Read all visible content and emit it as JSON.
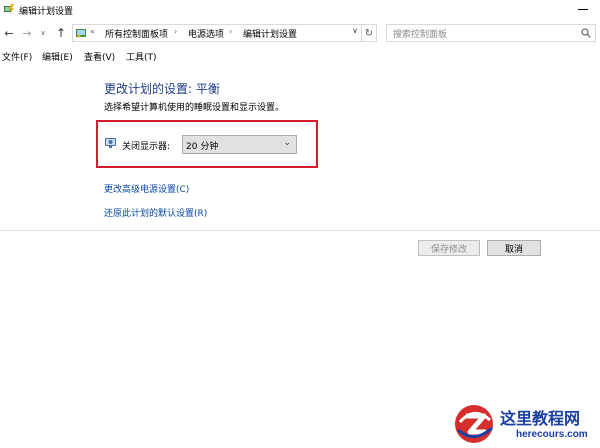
{
  "window": {
    "title": "编辑计划设置"
  },
  "nav": {
    "back": "←",
    "forward": "→",
    "up": "↑",
    "dropdown": "∨"
  },
  "address": {
    "overflow": "«",
    "crumbs": [
      "所有控制面板项",
      "电源选项",
      "编辑计划设置"
    ],
    "separator": "›",
    "dropdown": "∨",
    "refresh": "↻"
  },
  "search": {
    "placeholder": "搜索控制面板"
  },
  "menu": {
    "items": [
      "文件(F)",
      "编辑(E)",
      "查看(V)",
      "工具(T)"
    ]
  },
  "content": {
    "heading": "更改计划的设置: 平衡",
    "description": "选择希望计算机使用的睡眠设置和显示设置。",
    "display_off": {
      "label": "关闭显示器:",
      "value": "20 分钟"
    },
    "links": {
      "advanced": "更改高级电源设置(C)",
      "restore": "还原此计划的默认设置(R)"
    }
  },
  "buttons": {
    "save": "保存修改",
    "cancel": "取消"
  },
  "watermark": {
    "title": "这里教程网",
    "url": "herecours.com"
  },
  "colors": {
    "accent_red": "#d01f2a",
    "link_blue": "#0a4aa0",
    "heading_blue": "#1e3a8a",
    "watermark_blue": "#1a3fa2"
  },
  "icons": {
    "app": "power-options-icon",
    "address": "control-panel-icon",
    "search": "search-icon",
    "monitor": "monitor-icon",
    "refresh": "refresh-icon",
    "dropdown": "chevron-down-icon",
    "watermark": "site-logo"
  }
}
